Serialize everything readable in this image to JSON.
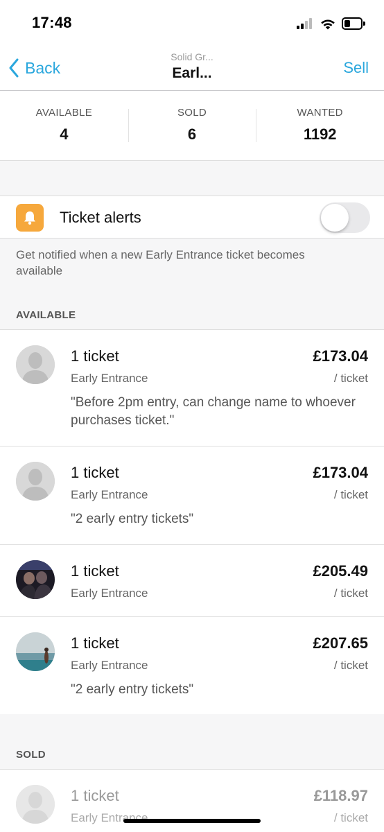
{
  "status_bar": {
    "time": "17:48"
  },
  "nav": {
    "back_label": "Back",
    "subtitle": "Solid Gr...",
    "title": "Earl...",
    "sell_label": "Sell"
  },
  "stats": [
    {
      "label": "AVAILABLE",
      "value": "4"
    },
    {
      "label": "SOLD",
      "value": "6"
    },
    {
      "label": "WANTED",
      "value": "1192"
    }
  ],
  "alerts": {
    "label": "Ticket alerts",
    "enabled": false,
    "description": "Get notified when a new Early Entrance ticket becomes available",
    "icon": "bell-icon",
    "icon_color": "#f6a83c"
  },
  "available": {
    "header": "AVAILABLE",
    "listings": [
      {
        "qty": "1 ticket",
        "type": "Early Entrance",
        "price": "£173.04",
        "per": "/ ticket",
        "note": "\"Before 2pm entry, can change name to whoever purchases ticket.\"",
        "avatar": "default-avatar"
      },
      {
        "qty": "1 ticket",
        "type": "Early Entrance",
        "price": "£173.04",
        "per": "/ ticket",
        "note": "\"2 early entry tickets\"",
        "avatar": "default-avatar"
      },
      {
        "qty": "1 ticket",
        "type": "Early Entrance",
        "price": "£205.49",
        "per": "/ ticket",
        "note": "",
        "avatar": "photo-avatar-group"
      },
      {
        "qty": "1 ticket",
        "type": "Early Entrance",
        "price": "£207.65",
        "per": "/ ticket",
        "note": "\"2 early entry tickets\"",
        "avatar": "photo-avatar-beach"
      }
    ]
  },
  "sold": {
    "header": "SOLD",
    "listings": [
      {
        "qty": "1 ticket",
        "type": "Early Entrance",
        "price": "£118.97",
        "per": "/ ticket",
        "avatar": "default-avatar"
      }
    ]
  },
  "colors": {
    "accent": "#2aa7dd",
    "alert_icon_bg": "#f6a83c",
    "section_bg": "#f6f6f7"
  }
}
